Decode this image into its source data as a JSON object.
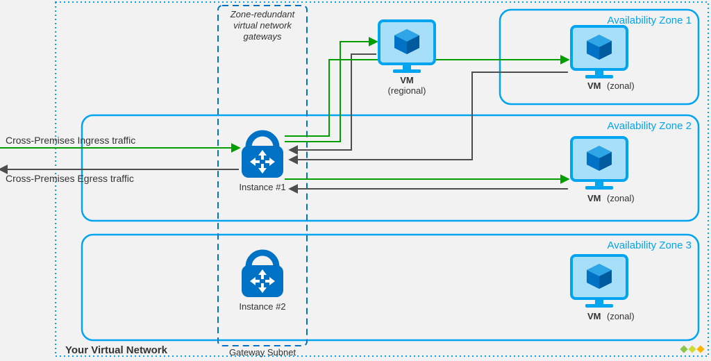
{
  "vnet_label": "Your Virtual Network",
  "gateway_subnet_label": "Gateway Subnet",
  "gateway_title_line1": "Zone-redundant",
  "gateway_title_line2": "virtual network",
  "gateway_title_line3": "gateways",
  "instances": {
    "one": "Instance #1",
    "two": "Instance #2"
  },
  "zones": {
    "z1": "Availability Zone 1",
    "z2": "Availability Zone 2",
    "z3": "Availability Zone 3"
  },
  "vm": {
    "label": "VM",
    "regional": "(regional)",
    "zonal": "(zonal)"
  },
  "traffic": {
    "ingress": "Cross-Premises Ingress traffic",
    "egress": "Cross-Premises Egress traffic"
  },
  "colors": {
    "azure": "#00a4ef",
    "azure_dark": "#0072c6",
    "green": "#009e00",
    "grey": "#4d4d4d",
    "light": "#a6dff7"
  }
}
